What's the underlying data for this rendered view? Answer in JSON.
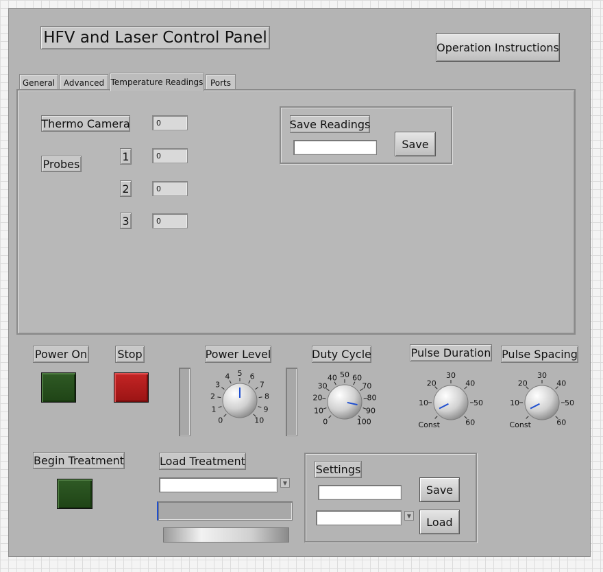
{
  "panel": {
    "title": "HFV and Laser Control Panel",
    "instructions_button": "Operation Instructions"
  },
  "tabs": [
    "General",
    "Advanced",
    "Temperature Readings",
    "Ports"
  ],
  "active_tab": "Temperature Readings",
  "temperature": {
    "thermo_label": "Thermo Camera",
    "thermo_value": "0",
    "probes_label": "Probes",
    "probes": [
      {
        "index": "1",
        "value": "0"
      },
      {
        "index": "2",
        "value": "0"
      },
      {
        "index": "3",
        "value": "0"
      }
    ],
    "save_group_label": "Save Readings",
    "save_path": "",
    "save_button": "Save"
  },
  "controls": {
    "power_on_label": "Power On",
    "stop_label": "Stop",
    "power_level_label": "Power Level",
    "duty_cycle_label": "Duty Cycle",
    "pulse_duration_label": "Pulse Duration",
    "pulse_spacing_label": "Pulse Spacing",
    "begin_treatment_label": "Begin Treatment",
    "load_treatment_label": "Load Treatment",
    "load_treatment_value": "",
    "settings_label": "Settings",
    "settings_save_button": "Save",
    "settings_load_button": "Load",
    "settings_name": "",
    "settings_selection": ""
  },
  "knobs": {
    "power_level": {
      "ticks": [
        "0",
        "1",
        "2",
        "3",
        "4",
        "5",
        "6",
        "7",
        "8",
        "9",
        "10"
      ],
      "value": 5,
      "min": 0,
      "max": 10
    },
    "duty_cycle": {
      "ticks": [
        "0",
        "10",
        "20",
        "30",
        "40",
        "50",
        "60",
        "70",
        "80",
        "90",
        "100"
      ],
      "value": 88,
      "min": 0,
      "max": 100
    },
    "pulse_duration": {
      "ticks": [
        "Const",
        "10",
        "20",
        "30",
        "40",
        "50",
        "60"
      ],
      "value": 4,
      "min": 0,
      "max": 60
    },
    "pulse_spacing": {
      "ticks": [
        "Const",
        "10",
        "20",
        "30",
        "40",
        "50",
        "60"
      ],
      "value": 4,
      "min": 0,
      "max": 60
    }
  },
  "colors": {
    "panel_bg": "#b4b4b4",
    "led_green": "#2a5221",
    "led_red": "#b81d1d",
    "needle": "#1f4fd0"
  },
  "icons": {
    "dropdown": "triangle-down-icon"
  }
}
